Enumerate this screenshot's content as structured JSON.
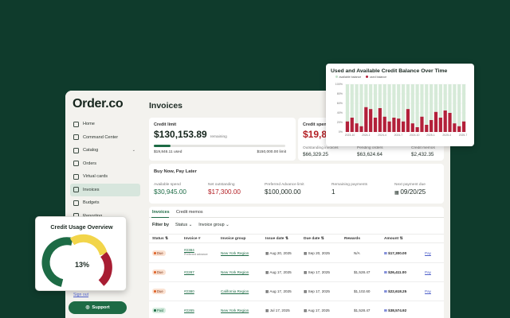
{
  "app": {
    "logo": "Order.co",
    "page_title": "Invoices"
  },
  "sidebar": {
    "items": [
      {
        "label": "Home",
        "icon": "home-icon",
        "chevron": false,
        "active": false
      },
      {
        "label": "Command Center",
        "icon": "command-center-icon",
        "chevron": false,
        "active": false
      },
      {
        "label": "Catalog",
        "icon": "catalog-icon",
        "chevron": true,
        "active": false
      },
      {
        "label": "Orders",
        "icon": "orders-icon",
        "chevron": false,
        "active": false
      },
      {
        "label": "Virtual cards",
        "icon": "card-icon",
        "chevron": false,
        "active": false
      },
      {
        "label": "Invoices",
        "icon": "invoice-icon",
        "chevron": false,
        "active": true
      },
      {
        "label": "Budgets",
        "icon": "budget-icon",
        "chevron": false,
        "active": false
      },
      {
        "label": "Reporting",
        "icon": "reporting-icon",
        "chevron": false,
        "active": false
      }
    ],
    "sign_out": "Sign out",
    "support": "Support"
  },
  "credit_limit": {
    "label": "Credit limit",
    "amount": "$130,153.89",
    "remaining": "remaining",
    "used": "$19,846.11 used",
    "limit": "$150,000.00 limit",
    "used_fraction": 0.13
  },
  "credit_spend": {
    "label": "Credit spend",
    "amount": "$19,84",
    "stats": [
      {
        "label": "Outstanding invoices",
        "value": "$66,329.25"
      },
      {
        "label": "Pending orders",
        "value": "$63,624.64"
      },
      {
        "label": "Credit memos",
        "value": "$2,432.35"
      }
    ]
  },
  "bnpl": {
    "title": "Buy Now, Pay Later",
    "stats": [
      {
        "label": "Available spend",
        "value": "$30,945.00",
        "tone": "grn"
      },
      {
        "label": "Net outstanding",
        "value": "$17,300.00",
        "tone": "red"
      },
      {
        "label": "Preferred Advance limit",
        "value": "$100,000.00",
        "tone": ""
      },
      {
        "label": "Remaining payments",
        "value": "1",
        "tone": ""
      },
      {
        "label": "Next payment due",
        "value": "09/20/25",
        "tone": ""
      }
    ]
  },
  "tabs": [
    {
      "label": "Invoices",
      "active": true
    },
    {
      "label": "Credit memos",
      "active": false
    }
  ],
  "filter": {
    "label": "Filter by",
    "status": "Status",
    "group": "Invoice group"
  },
  "table": {
    "headers": [
      "Status",
      "Invoice #",
      "Invoice group",
      "Issue date",
      "Due date",
      "Rewards",
      "Amount"
    ],
    "rows": [
      {
        "status": "Due",
        "status_type": "due",
        "invoice": "#2384",
        "note": "Preferred advance",
        "group": "New York Region",
        "issue": "Aug 20, 2025",
        "due": "Sep 20, 2025",
        "rewards": "N/A",
        "amount": "$17,300.00",
        "action": "Pay"
      },
      {
        "status": "Due",
        "status_type": "due",
        "invoice": "#2287",
        "note": "",
        "group": "New York Region",
        "issue": "Aug 17, 2025",
        "due": "Sep 17, 2025",
        "rewards": "$1,528.47",
        "amount": "$26,411.00",
        "action": "Pay"
      },
      {
        "status": "Due",
        "status_type": "due",
        "invoice": "#2380",
        "note": "",
        "group": "California Region",
        "issue": "Aug 17, 2025",
        "due": "Sep 17, 2025",
        "rewards": "$1,102.60",
        "amount": "$22,618.25",
        "action": "Pay"
      },
      {
        "status": "Paid",
        "status_type": "paid",
        "invoice": "#2265",
        "note": "",
        "group": "New York Region",
        "issue": "Jul 17, 2025",
        "due": "Aug 17, 2025",
        "rewards": "$1,528.47",
        "amount": "$38,574.92",
        "action": ""
      }
    ]
  },
  "chart_data": {
    "type": "bar",
    "title": "Used and Available Credit Balance Over Time",
    "legend": [
      "available balance",
      "used balance"
    ],
    "colors": {
      "available": "#d6ead8",
      "used": "#b3203a"
    },
    "ylim": [
      0,
      100
    ],
    "y_ticks": [
      "100%",
      "80%",
      "60%",
      "40%",
      "20%",
      "0%"
    ],
    "x_ticks": [
      "2023-10",
      "2024-1",
      "2024-4",
      "2024-7",
      "2024-10",
      "2025-1",
      "2025-4",
      "2025-7"
    ],
    "used_values": [
      22,
      30,
      18,
      12,
      52,
      48,
      30,
      50,
      32,
      22,
      30,
      28,
      22,
      48,
      18,
      10,
      32,
      15,
      25,
      42,
      30,
      45,
      40,
      18,
      12,
      22
    ],
    "available_values": [
      100,
      100,
      100,
      100,
      100,
      100,
      100,
      100,
      100,
      100,
      100,
      100,
      100,
      100,
      100,
      100,
      100,
      100,
      100,
      100,
      100,
      100,
      100,
      100,
      100,
      100
    ]
  },
  "gauge": {
    "title": "Credit Usage Overview",
    "value_label": "13%",
    "value": 13,
    "colors": {
      "low": "#1d6b45",
      "mid": "#f2d54a",
      "high": "#a81d33"
    }
  }
}
